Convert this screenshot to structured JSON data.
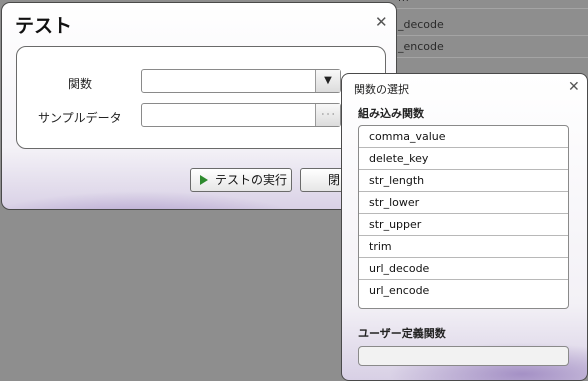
{
  "background_list": {
    "items": [
      "m",
      "_decode",
      "_encode"
    ]
  },
  "dialog": {
    "title": "テスト",
    "fields": {
      "function_label": "関数",
      "function_value": "",
      "sample_label": "サンプルデータ",
      "sample_value": "",
      "dropdown_glyph": "▼",
      "browse_glyph": "· · ·"
    },
    "buttons": {
      "run_label": "テストの実行",
      "close_label": "閉じ"
    },
    "close_glyph": "✕"
  },
  "popup": {
    "title": "関数の選択",
    "close_glyph": "✕",
    "builtin_header": "組み込み関数",
    "builtin_functions": [
      "comma_value",
      "delete_key",
      "str_length",
      "str_lower",
      "str_upper",
      "trim",
      "url_decode",
      "url_encode"
    ],
    "user_header": "ユーザー定義関数",
    "user_functions": []
  },
  "icons": {
    "run_button_icon": "play-icon",
    "run_icon_color": "#2d8a2d"
  }
}
